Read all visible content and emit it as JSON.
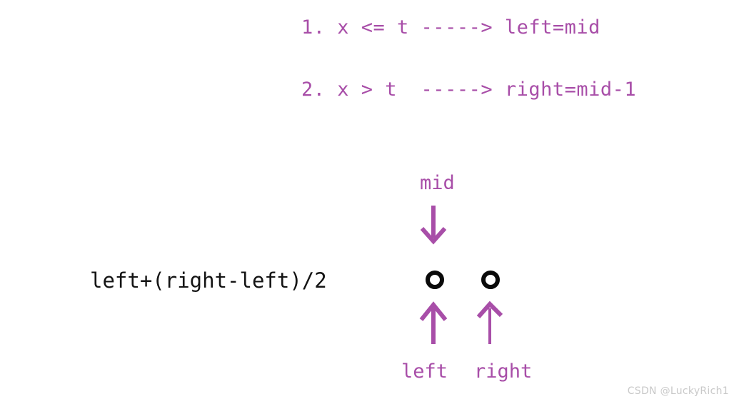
{
  "page": {
    "background_color": "#ffffff",
    "accent_color": "#a84ea8",
    "text_color": "#141414",
    "node_color": "#0a0a0a",
    "watermark_color": "#c9c9c9"
  },
  "rules": [
    {
      "text": "1. x <= t -----> left=mid"
    },
    {
      "text": "2. x > t  -----> right=mid-1"
    }
  ],
  "diagram": {
    "mid_label": "mid",
    "formula": "left+(right-left)/2",
    "pointers": [
      {
        "label": "left"
      },
      {
        "label": "right"
      }
    ],
    "nodes": [
      {
        "name": "left-node"
      },
      {
        "name": "right-node"
      }
    ]
  },
  "watermark": {
    "text": "CSDN @LuckyRich1"
  }
}
